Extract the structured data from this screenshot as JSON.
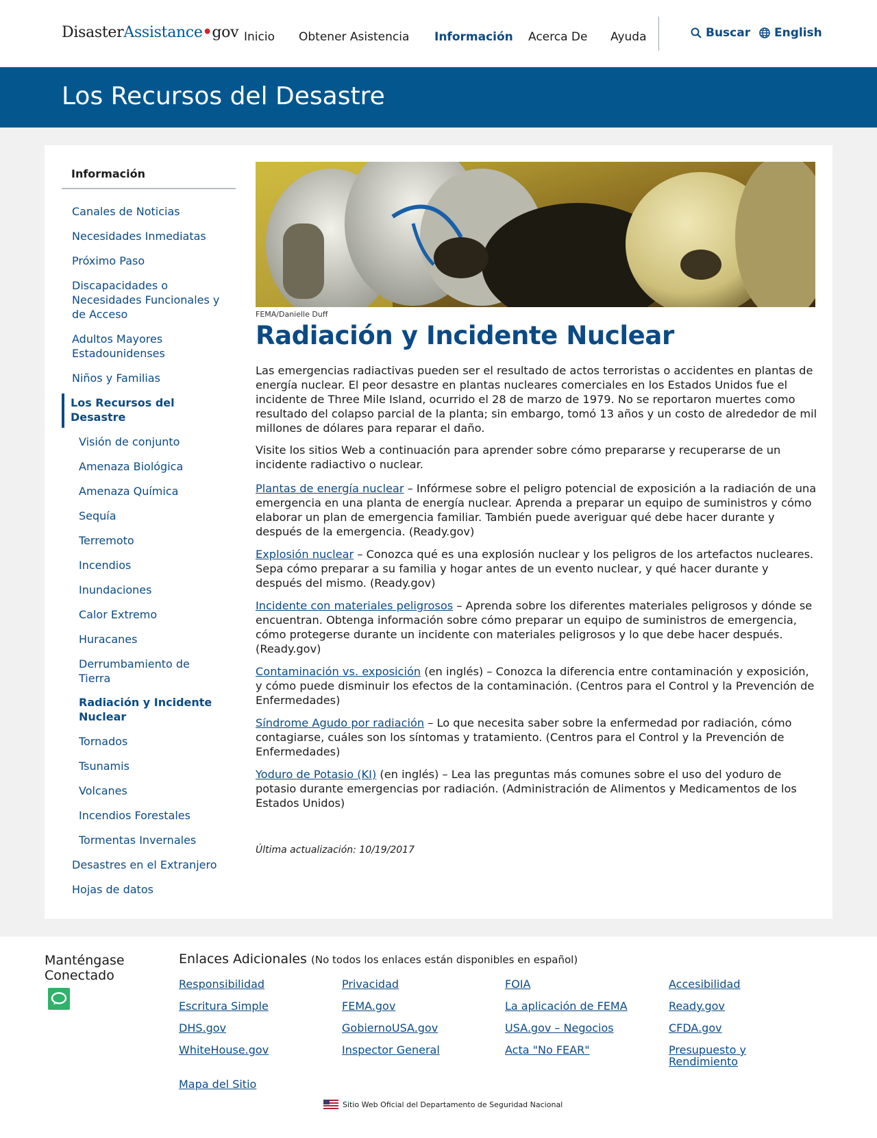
{
  "header": {
    "logo_part1": "Disaster",
    "logo_part2": "Assistance",
    "logo_dot": "•",
    "logo_part3": "gov",
    "nav": [
      "Inicio",
      "Obtener Asistencia",
      "Información",
      "Acerca De",
      "Ayuda"
    ],
    "search_label": "Buscar",
    "language_label": "English"
  },
  "banner": {
    "title": "Los Recursos del Desastre"
  },
  "sidebar": {
    "heading": "Información",
    "items": [
      "Canales de Noticias",
      "Necesidades Inmediatas",
      "Próximo Paso",
      "Discapacidades o Necesidades Funcionales y de Acceso",
      "Adultos Mayores Estadounidenses",
      "Niños y Familias",
      "Los Recursos del Desastre"
    ],
    "subitems": [
      "Visión de conjunto",
      "Amenaza Biológica",
      "Amenaza Química",
      "Sequía",
      "Terremoto",
      "Incendios",
      "Inundaciones",
      "Calor Extremo",
      "Huracanes",
      "Derrumbamiento de Tierra",
      "Radiación y Incidente Nuclear",
      "Tornados",
      "Tsunamis",
      "Volcanes",
      "Incendios Forestales",
      "Tormentas Invernales"
    ],
    "bottom_items": [
      "Desastres en el Extranjero",
      "Hojas de datos"
    ]
  },
  "main": {
    "image_credit": "FEMA/Danielle Duff",
    "title": "Radiación y Incidente Nuclear",
    "intro": "Las emergencias radiactivas pueden ser el resultado de actos terroristas o accidentes en plantas de energía nuclear. El peor desastre en plantas nucleares comerciales en los Estados Unidos fue el incidente de Three Mile Island, ocurrido el 28 de marzo de 1979. No se reportaron muertes como resultado del colapso parcial de la planta; sin embargo, tomó 13 años y un costo de alrededor de mil millones de dólares para reparar el daño.",
    "visit": "Visite los sitios Web a continuación para aprender sobre cómo prepararse y recuperarse de un incidente radiactivo o nuclear.",
    "resources": [
      {
        "link": "Plantas de energía nuclear",
        "text": " – Infórmese sobre el peligro potencial de exposición a la radiación de una emergencia en una planta de energía nuclear. Aprenda a preparar un equipo de suministros y cómo elaborar un plan de emergencia familiar. También puede averiguar qué debe hacer durante y después de la emergencia. (Ready.gov)"
      },
      {
        "link": "Explosión nuclear",
        "text": " – Conozca qué es una explosión nuclear y los peligros de los artefactos nucleares. Sepa cómo preparar a su familia y hogar antes de un evento nuclear, y qué hacer durante y después del mismo. (Ready.gov)"
      },
      {
        "link": "Incidente con materiales peligrosos",
        "text": " – Aprenda sobre los diferentes materiales peligrosos y dónde se encuentran. Obtenga información sobre cómo preparar un equipo de suministros de emergencia, cómo protegerse durante un incidente con materiales peligrosos y lo que debe hacer después. (Ready.gov)"
      },
      {
        "link": "Contaminación vs. exposición",
        "text": " (en inglés) – Conozca la diferencia entre contaminación y exposición, y cómo puede disminuir los efectos de la contaminación. (Centros para el Control y la Prevención de Enfermedades)"
      },
      {
        "link": "Síndrome Agudo por radiación",
        "text": " – Lo que necesita saber sobre la enfermedad por radiación, cómo contagiarse, cuáles son los síntomas y tratamiento. (Centros para el Control y la Prevención de Enfermedades)"
      },
      {
        "link": "Yoduro de Potasio (KI)",
        "text": " (en inglés) – Lea las preguntas más comunes sobre el uso del yoduro de potasio durante emergencias por radiación. (Administración de Alimentos y Medicamentos de los Estados Unidos)"
      }
    ],
    "last_updated": "Última actualización: 10/19/2017"
  },
  "footer": {
    "connect": "Manténgase Conectado",
    "links_heading": "Enlaces Adicionales",
    "links_note": "(No todos los enlaces están disponibles en español)",
    "links": [
      "Responsibilidad",
      "Privacidad",
      "FOIA",
      "Accesibilidad",
      "Escritura Simple",
      "FEMA.gov",
      "La aplicación de FEMA",
      "Ready.gov",
      "DHS.gov",
      "GobiernoUSA.gov",
      "USA.gov – Negocios",
      "CFDA.gov",
      "WhiteHouse.gov",
      "Inspector General",
      "Acta \"No FEAR\"",
      "Presupuesto y Rendimiento",
      "Mapa del Sitio"
    ],
    "official": "Sitio Web Oficial del Departamento de Seguridad Nacional"
  },
  "colors": {
    "brand_blue": "#04578e",
    "link_blue": "#0b4a85",
    "chat_green": "#2fb26a",
    "logo_red": "#d3242b"
  }
}
